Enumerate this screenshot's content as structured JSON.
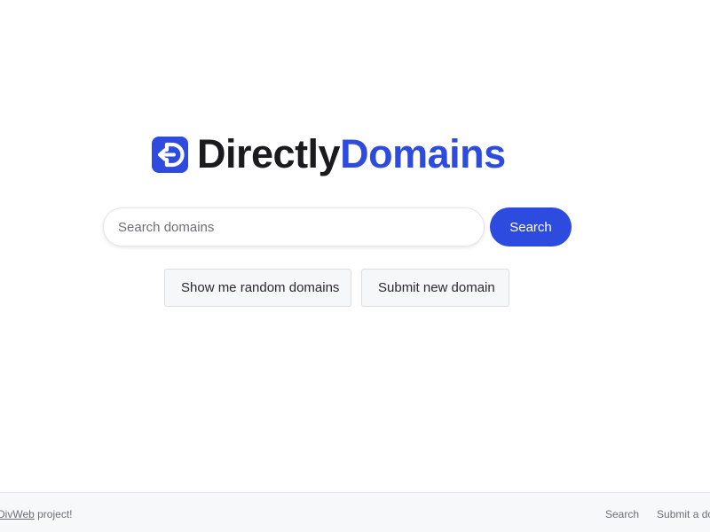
{
  "brand": {
    "name_part_1": "Directly",
    "name_part_2": "Domains",
    "logo_icon": "directlydomains-logo-icon",
    "colors": {
      "dark_text": "#1b1b1f",
      "accent": "#2e4be0"
    }
  },
  "search": {
    "value": "",
    "placeholder": "Search domains",
    "button_label": "Search"
  },
  "actions": {
    "random_label": "Show me random domains",
    "submit_label": "Submit new domain"
  },
  "footer": {
    "project_link": "DivWeb",
    "project_suffix": " project!",
    "nav": {
      "search_label": "Search",
      "submit_label": "Submit a domain"
    }
  }
}
